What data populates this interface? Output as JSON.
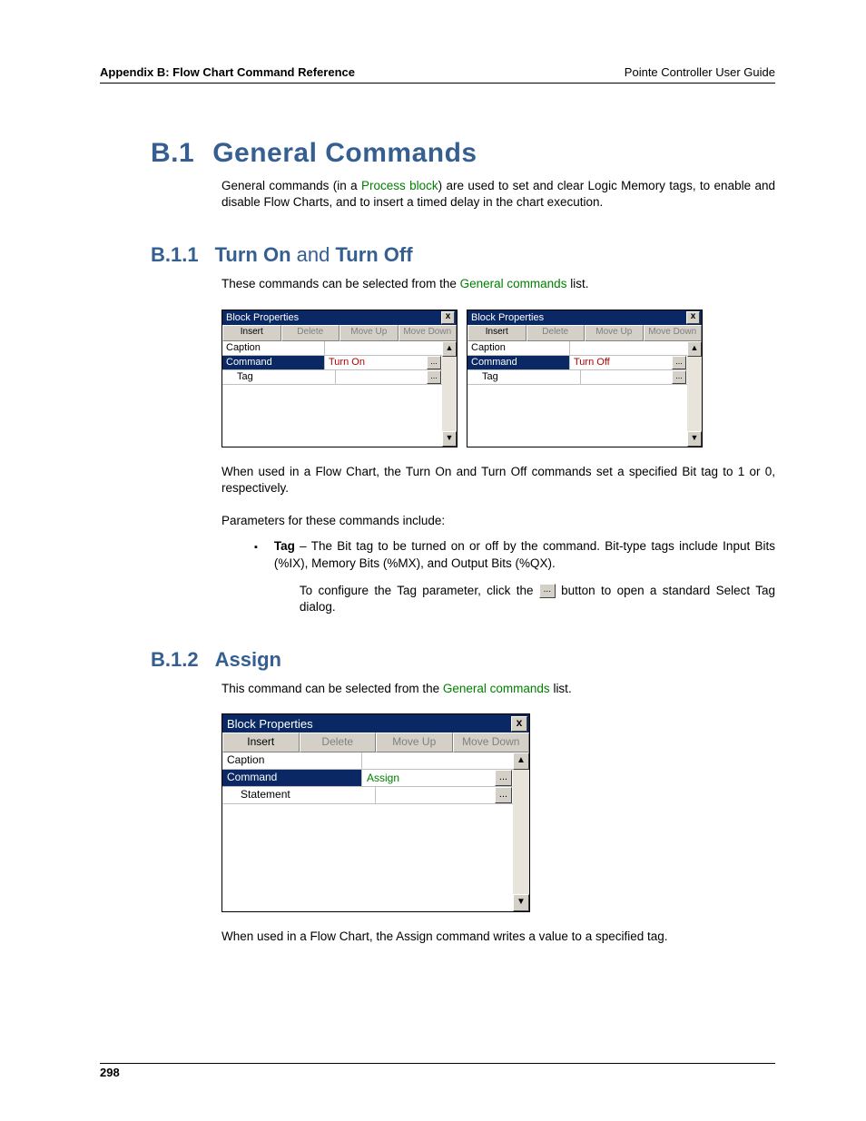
{
  "header": {
    "left": "Appendix B: Flow Chart Command Reference",
    "right": "Pointe Controller User Guide"
  },
  "h1": {
    "num": "B.1",
    "title": "General Commands"
  },
  "p1_a": "General commands (in a ",
  "p1_link": "Process block",
  "p1_b": ") are used to set and clear Logic Memory tags, to enable and disable Flow Charts, and to insert a timed delay in the chart execution.",
  "h2_1": {
    "num": "B.1.1",
    "pre": "Turn On",
    "mid": " and ",
    "post": "Turn Off"
  },
  "p2_a": "These commands can be selected from the ",
  "p2_link": "General commands",
  "p2_b": " list.",
  "dialog": {
    "title": "Block Properties",
    "buttons": {
      "insert": "Insert",
      "delete": "Delete",
      "moveup": "Move Up",
      "movedown": "Move Down"
    },
    "rows": {
      "caption": "Caption",
      "command": "Command",
      "tag": "Tag",
      "statement": "Statement"
    }
  },
  "cmd": {
    "turnon": "Turn On",
    "turnoff": "Turn Off",
    "assign": "Assign"
  },
  "ellipsis": "...",
  "arrow_up": "▲",
  "arrow_down": "▼",
  "close_x": "x",
  "p3": "When used in a Flow Chart, the Turn On and Turn Off commands set a specified Bit tag to 1 or 0, respectively.",
  "p4": "Parameters for these commands include:",
  "bullet1_label": "Tag",
  "bullet1_rest": " – The Bit tag to be turned on or off by the command. Bit-type tags include Input Bits (%IX), Memory Bits (%MX), and Output Bits (%QX).",
  "bullet1_cont_a": "To configure the Tag parameter, click the ",
  "bullet1_cont_b": " button to open a standard ",
  "bullet1_cont_link": "Select Tag",
  "bullet1_cont_c": " dialog.",
  "h2_2": {
    "num": "B.1.2",
    "title": "Assign"
  },
  "p5_a": "This command can be selected from the ",
  "p5_link": "General commands",
  "p5_b": " list.",
  "p6": "When used in a Flow Chart, the Assign command writes a value to a specified tag.",
  "pagenum": "298"
}
